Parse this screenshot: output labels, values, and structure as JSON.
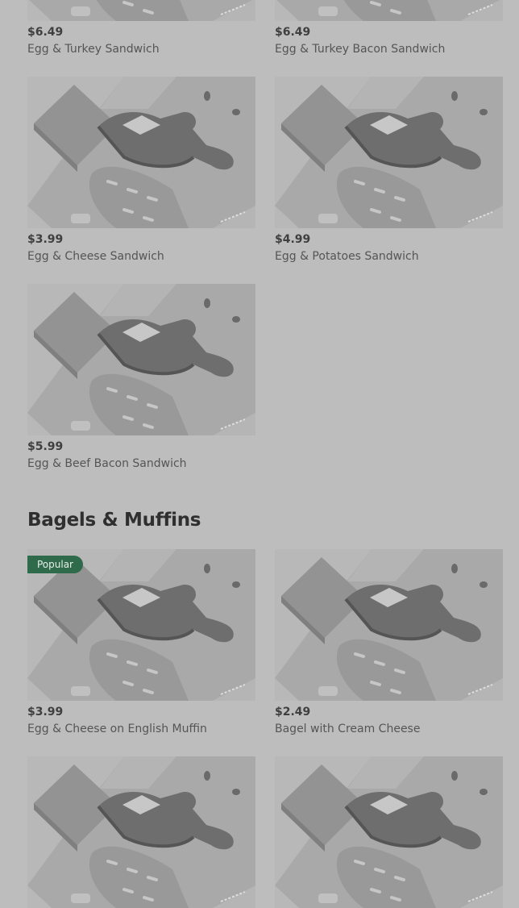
{
  "sections": [
    {
      "title": "",
      "items": [
        {
          "price": "$6.49",
          "name": "Egg & Turkey Sandwich"
        },
        {
          "price": "$6.49",
          "name": "Egg & Turkey Bacon Sandwich"
        },
        {
          "price": "$3.99",
          "name": "Egg & Cheese Sandwich"
        },
        {
          "price": "$4.99",
          "name": "Egg & Potatoes Sandwich"
        },
        {
          "price": "$5.99",
          "name": "Egg & Beef Bacon Sandwich"
        }
      ]
    },
    {
      "title": "Bagels & Muffins",
      "items": [
        {
          "price": "$3.99",
          "name": "Egg & Cheese on English Muffin",
          "badge": "Popular"
        },
        {
          "price": "$2.49",
          "name": "Bagel with Cream Cheese"
        },
        {
          "price": "",
          "name": ""
        },
        {
          "price": "",
          "name": ""
        }
      ]
    }
  ],
  "placeholder_icon": "bread-and-bottle-illustration",
  "colors": {
    "overlay_bg": "#bdbdbd",
    "image_bg": "#a9a9a9",
    "badge_bg": "#2f6b4a"
  }
}
